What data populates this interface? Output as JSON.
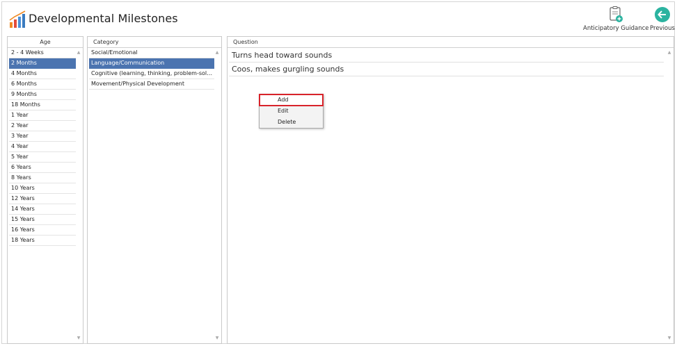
{
  "header": {
    "title": "Developmental Milestones",
    "logo_colors": [
      "#f08a24",
      "#4a90d9",
      "#3a7bbf",
      "#e24c3c"
    ]
  },
  "toolbar": {
    "anticipatory_guidance_label": "Anticipatory Guidance",
    "previous_label": "Previous",
    "accent_color": "#2bb3a0"
  },
  "age_panel": {
    "header": "Age",
    "selected_index": 1,
    "items": [
      "2 - 4 Weeks",
      "2 Months",
      "4 Months",
      "6 Months",
      "9 Months",
      "18 Months",
      "1 Year",
      "2 Year",
      "3 Year",
      "4 Year",
      "5 Year",
      "6 Years",
      "8 Years",
      "10 Years",
      "12 Years",
      "14 Years",
      "15 Years",
      "16 Years",
      "18 Years"
    ]
  },
  "category_panel": {
    "header": "Category",
    "selected_index": 1,
    "items": [
      "Social/Emotional",
      "Language/Communication",
      "Cognitive (learning, thinking, problem-solvi...",
      "Movement/Physical Development"
    ]
  },
  "question_panel": {
    "header": "Question",
    "items": [
      "Turns head toward sounds",
      "Coos, makes gurgling sounds"
    ]
  },
  "context_menu": {
    "items": [
      "Add",
      "Edit",
      "Delete"
    ],
    "highlighted_index": 0,
    "highlight_color": "#d8232a"
  },
  "selection_color": "#4b74b0"
}
